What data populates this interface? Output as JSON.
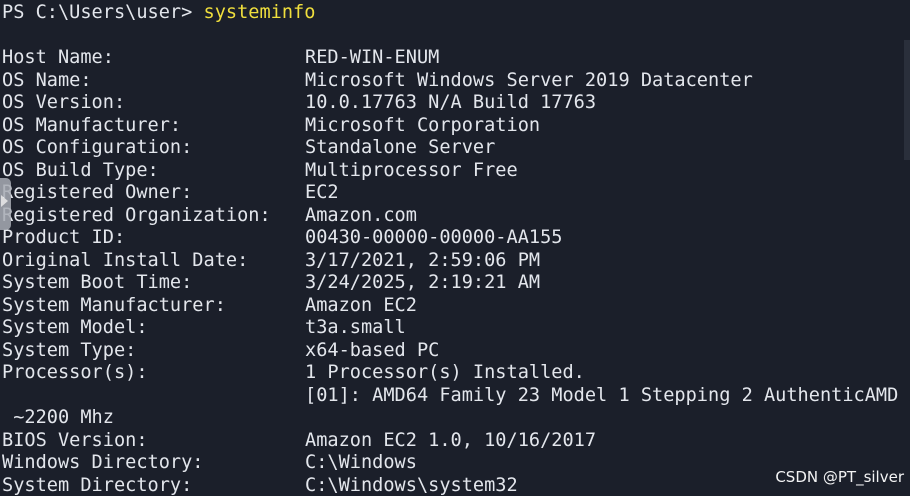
{
  "prompt": {
    "text": "PS C:\\Users\\user> ",
    "command": "systeminfo"
  },
  "rows": [
    {
      "key": "Host Name:",
      "value": "RED-WIN-ENUM"
    },
    {
      "key": "OS Name:",
      "value": "Microsoft Windows Server 2019 Datacenter"
    },
    {
      "key": "OS Version:",
      "value": "10.0.17763 N/A Build 17763"
    },
    {
      "key": "OS Manufacturer:",
      "value": "Microsoft Corporation"
    },
    {
      "key": "OS Configuration:",
      "value": "Standalone Server"
    },
    {
      "key": "OS Build Type:",
      "value": "Multiprocessor Free"
    },
    {
      "key": "Registered Owner:",
      "value": "EC2"
    },
    {
      "key": "Registered Organization:",
      "value": "Amazon.com"
    },
    {
      "key": "Product ID:",
      "value": "00430-00000-00000-AA155"
    },
    {
      "key": "Original Install Date:",
      "value": "3/17/2021, 2:59:06 PM"
    },
    {
      "key": "System Boot Time:",
      "value": "3/24/2025, 2:19:21 AM"
    },
    {
      "key": "System Manufacturer:",
      "value": "Amazon EC2"
    },
    {
      "key": "System Model:",
      "value": "t3a.small"
    },
    {
      "key": "System Type:",
      "value": "x64-based PC"
    },
    {
      "key": "Processor(s):",
      "value": "1 Processor(s) Installed."
    },
    {
      "key": "",
      "value": "[01]: AMD64 Family 23 Model 1 Stepping 2 AuthenticAMD"
    },
    {
      "continuation": " ~2200 Mhz"
    },
    {
      "key": "BIOS Version:",
      "value": "Amazon EC2 1.0, 10/16/2017"
    },
    {
      "key": "Windows Directory:",
      "value": "C:\\Windows"
    },
    {
      "key": "System Directory:",
      "value": "C:\\Windows\\system32"
    }
  ],
  "watermark": "CSDN @PT_silver",
  "colors": {
    "background": "#1b1f2a",
    "text": "#e3e6ec",
    "command": "#f0df3d"
  },
  "icons": {
    "side_tab": "expand-arrow-icon"
  }
}
